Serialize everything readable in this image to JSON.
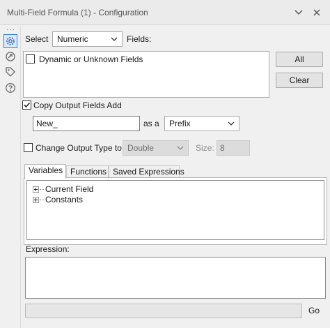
{
  "window": {
    "title": "Multi-Field Formula (1) - Configuration"
  },
  "sidebar": {
    "dots": "···"
  },
  "select_row": {
    "select_label": "Select",
    "type_value": "Numeric",
    "fields_label": "Fields:"
  },
  "fields_list": {
    "items": [
      {
        "label": "Dynamic or Unknown Fields",
        "checked": false
      }
    ]
  },
  "buttons": {
    "all": "All",
    "clear": "Clear"
  },
  "copy_output": {
    "label": "Copy Output Fields Add",
    "checked": true,
    "value": "New_",
    "as_a_label": "as a",
    "position_value": "Prefix"
  },
  "change_type": {
    "label": "Change Output Type to",
    "checked": false,
    "type_value": "Double",
    "size_label": "Size:",
    "size_value": "8"
  },
  "tabs": [
    "Variables",
    "Functions",
    "Saved Expressions"
  ],
  "tree": {
    "items": [
      "Current Field",
      "Constants"
    ]
  },
  "expression": {
    "label": "Expression:",
    "value": ""
  },
  "go": {
    "label": "Go"
  }
}
